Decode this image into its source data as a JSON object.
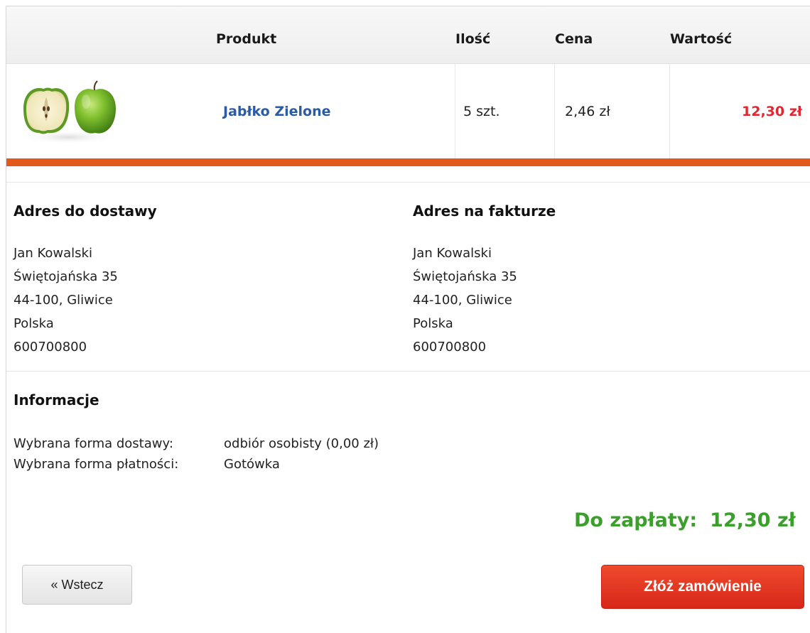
{
  "table": {
    "headers": {
      "product": "Produkt",
      "quantity": "Ilość",
      "price": "Cena",
      "value": "Wartość"
    },
    "rows": [
      {
        "image_icon": "green-apple-image",
        "name": "Jabłko Zielone",
        "quantity": "5 szt.",
        "price": "2,46 zł",
        "value": "12,30 zł"
      }
    ]
  },
  "shipping": {
    "title": "Adres do dostawy",
    "lines": [
      "Jan Kowalski",
      "Świętojańska 35",
      "44-100, Gliwice",
      "Polska",
      "600700800"
    ]
  },
  "billing": {
    "title": "Adres na fakturze",
    "lines": [
      "Jan Kowalski",
      "Świętojańska 35",
      "44-100, Gliwice",
      "Polska",
      "600700800"
    ]
  },
  "info": {
    "title": "Informacje",
    "delivery_label": "Wybrana forma dostawy:",
    "delivery_value": "odbiór osobisty (0,00 zł)",
    "payment_label": "Wybrana forma płatności:",
    "payment_value": "Gotówka"
  },
  "total": {
    "label": "Do zapłaty:",
    "amount": "12,30 zł"
  },
  "buttons": {
    "back": "« Wstecz",
    "order": "Złóż zamówienie"
  },
  "colors": {
    "accent_bar": "#e2591b",
    "link": "#2a5aa8",
    "value_red": "#e3262f",
    "total_green": "#3a9f2b",
    "order_button": "#e0351f"
  }
}
